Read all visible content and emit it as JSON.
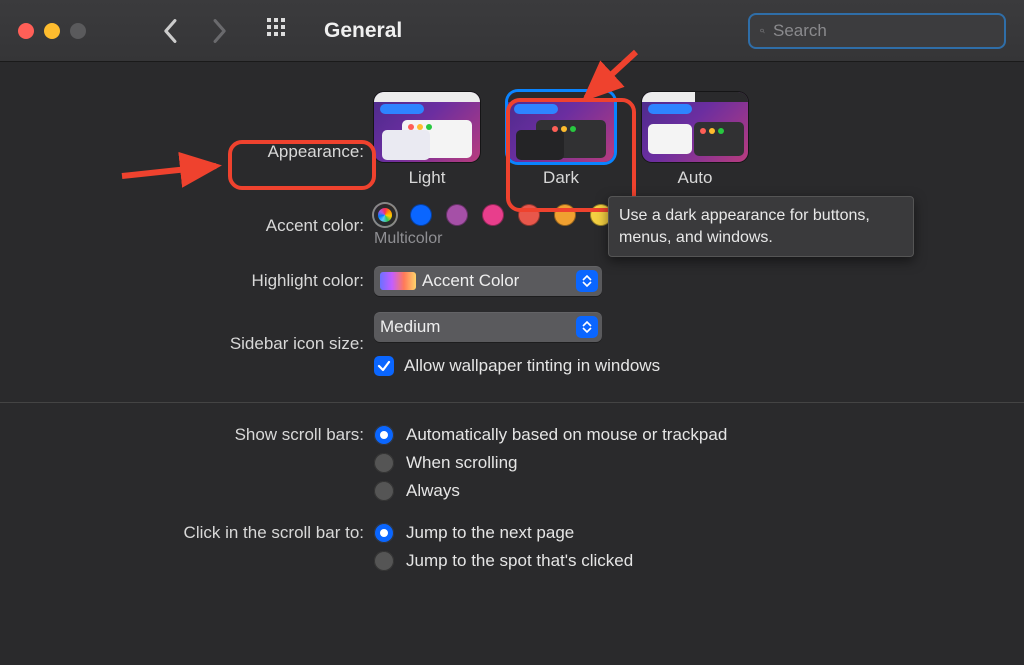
{
  "titlebar": {
    "title": "General",
    "search_placeholder": "Search"
  },
  "appearance": {
    "label": "Appearance:",
    "options": {
      "light": "Light",
      "dark": "Dark",
      "auto": "Auto"
    },
    "selected": "dark",
    "tooltip": "Use a dark appearance for buttons, menus, and windows."
  },
  "accent": {
    "label": "Accent color:",
    "selected_name": "Multicolor",
    "colors": [
      "multicolor",
      "#0a66ff",
      "#a550a7",
      "#e83e8c",
      "#e8574b",
      "#f0a030",
      "#f5d142"
    ]
  },
  "highlight": {
    "label": "Highlight color:",
    "value": "Accent Color"
  },
  "sidebar_icon": {
    "label": "Sidebar icon size:",
    "value": "Medium"
  },
  "wallpaper_tint": {
    "label": "Allow wallpaper tinting in windows",
    "checked": true
  },
  "scrollbars": {
    "label": "Show scroll bars:",
    "options": {
      "auto": "Automatically based on mouse or trackpad",
      "scrolling": "When scrolling",
      "always": "Always"
    },
    "selected": "auto"
  },
  "click_scroll": {
    "label": "Click in the scroll bar to:",
    "options": {
      "next_page": "Jump to the next page",
      "clicked_spot": "Jump to the spot that's clicked"
    },
    "selected": "next_page"
  },
  "annotations": {
    "box_appearance": true,
    "box_dark": true,
    "arrow_to_appearance": true,
    "arrow_to_dark": true
  }
}
